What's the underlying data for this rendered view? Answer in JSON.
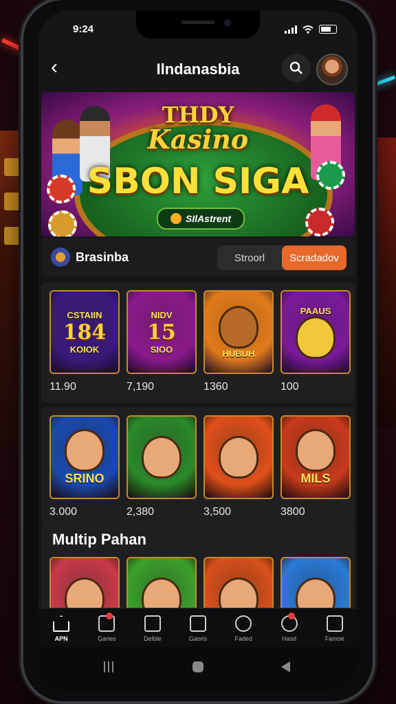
{
  "status": {
    "time": "9:24"
  },
  "header": {
    "title": "Ilndanasbia",
    "back_icon": "chevron-left-icon",
    "search_icon": "search-icon"
  },
  "banner": {
    "line1": "THDY",
    "line2": "Kasino",
    "line3": "SBON SIGA",
    "button_label": "SIlAstrent"
  },
  "brand": {
    "name": "Brasinba",
    "toggle": [
      "Stroorl",
      "Scradadov"
    ],
    "active_index": 1
  },
  "row1": [
    {
      "title_top": "CSTAIIN",
      "title_big": "184",
      "title_bottom": "KOIOK",
      "value": "11.90",
      "color": "#3a1a7a"
    },
    {
      "title_top": "NIDV",
      "title_big": "15",
      "title_bottom": "SIOO",
      "value": "7,190",
      "color": "#8a1a8a"
    },
    {
      "title_top": "",
      "title_big": "",
      "title_bottom": "HUBUH",
      "value": "1360",
      "color": "#e07a1a"
    },
    {
      "title_top": "PAAUS",
      "title_big": "",
      "title_bottom": "",
      "value": "100",
      "color": "#7a1a9a"
    }
  ],
  "row2": [
    {
      "label": "SRINO",
      "value": "3.000",
      "color": "#1a4ab0"
    },
    {
      "label": "",
      "value": "2,380",
      "color": "#2a8a2a"
    },
    {
      "label": "",
      "value": "3,500",
      "color": "#e0501a"
    },
    {
      "label": "MILS",
      "value": "3800",
      "color": "#c83a1a"
    }
  ],
  "section3": {
    "title": "Multip Pahan",
    "tiles": [
      "#c83a4a",
      "#3aa02a",
      "#d8501a",
      "#2a7ad8"
    ]
  },
  "tabbar": [
    {
      "label": "APN",
      "active": true,
      "badge": false
    },
    {
      "label": "Garies",
      "active": false,
      "badge": true
    },
    {
      "label": "Delble",
      "active": false,
      "badge": false
    },
    {
      "label": "Gaoris",
      "active": false,
      "badge": false
    },
    {
      "label": "Faded",
      "active": false,
      "badge": false
    },
    {
      "label": "Hasd",
      "active": false,
      "badge": true
    },
    {
      "label": "Famoe",
      "active": false,
      "badge": false
    }
  ],
  "colors": {
    "accent": "#e8682a",
    "background": "#161617"
  }
}
